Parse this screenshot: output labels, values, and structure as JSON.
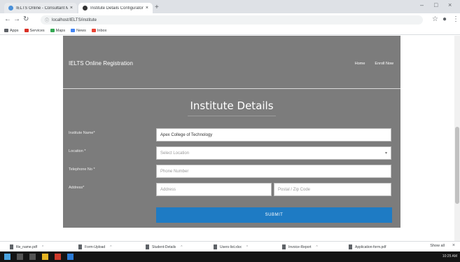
{
  "browser": {
    "tabs": [
      {
        "label": "IELTS Online - Consultant Mana",
        "active": false
      },
      {
        "label": "Institute Details Configurator",
        "active": true
      }
    ],
    "url": "localhost/IELTS/institute",
    "bookmarks": [
      "Apps",
      "Services",
      "Maps",
      "News",
      "Inbox"
    ]
  },
  "site": {
    "title": "IELTS Online Registration",
    "nav": [
      "Home",
      "Enroll Now"
    ]
  },
  "form": {
    "heading": "Institute Details",
    "institute_label": "Institute Name*",
    "institute_value": "Apex College of Technology",
    "location_label": "Location *",
    "location_placeholder": "Select Location",
    "telephone_label": "Telephone No *",
    "telephone_placeholder": "Phone Number",
    "address_label": "Address*",
    "address_placeholder": "Address",
    "postal_placeholder": "Postal / Zip Code",
    "submit_label": "SUBMIT"
  },
  "downloads": {
    "items": [
      "file_name.pdf",
      "Form-Upload",
      "Student-Details",
      "Users-list.xlsx",
      "Invoice-Report",
      "Application-form.pdf"
    ],
    "show_all": "Show all"
  },
  "taskbar": {
    "clock": "10:25 AM"
  },
  "colors": {
    "panel": "#7c7c7c",
    "submit": "#1e7bc4"
  }
}
